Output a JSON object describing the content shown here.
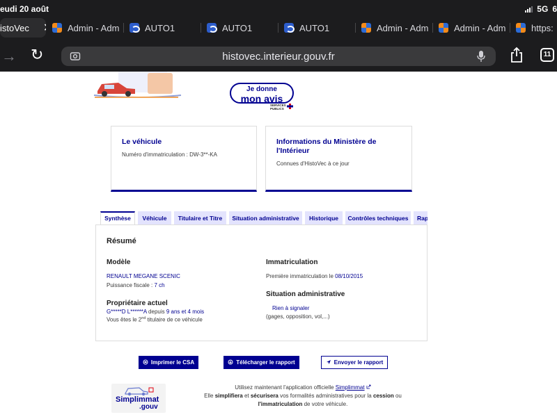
{
  "status_bar": {
    "date": "eudi 20 août",
    "network": "5G",
    "battery": "6"
  },
  "browser": {
    "tabs": [
      {
        "label": "istoVec",
        "active": true,
        "favicon": "none"
      },
      {
        "label": "Admin - Adm",
        "favicon": "admin-icon"
      },
      {
        "label": "AUTO1",
        "favicon": "auto1-icon"
      },
      {
        "label": "AUTO1",
        "favicon": "auto1-icon"
      },
      {
        "label": "AUTO1",
        "favicon": "auto1-icon"
      },
      {
        "label": "Admin - Adm",
        "favicon": "admin-icon"
      },
      {
        "label": "Admin - Adm",
        "favicon": "admin-icon"
      },
      {
        "label": "https:",
        "favicon": "admin-icon"
      }
    ],
    "url": "histovec.interieur.gouv.fr",
    "tab_count": "11"
  },
  "avis_button": {
    "line1": "Je donne",
    "line2": "mon avis",
    "logo_text": [
      "SERVICES",
      "PUBLICS"
    ]
  },
  "cards": [
    {
      "title": "Le véhicule",
      "desc": "Numéro d'immatriculation : DW-3**-KA"
    },
    {
      "title": "Informations du Ministère de l'Intérieur",
      "desc": "Connues d'HistoVec à ce jour"
    }
  ],
  "panel_tabs": [
    {
      "label": "Synthèse",
      "active": true
    },
    {
      "label": "Véhicule"
    },
    {
      "label": "Titulaire et Titre"
    },
    {
      "label": "Situation administrative"
    },
    {
      "label": "Historique"
    },
    {
      "label": "Contrôles techniques"
    },
    {
      "label": "Rap"
    }
  ],
  "summary": {
    "title": "Résumé",
    "modele": {
      "heading": "Modèle",
      "name": "RENAULT MEGANE SCENIC",
      "puissance_label": "Puissance fiscale :",
      "puissance_value": "7 ch"
    },
    "proprietaire": {
      "heading": "Propriétaire actuel",
      "name": "G*****D L******A",
      "since_label": "depuis",
      "since_value": "9 ans et 4 mois",
      "rank_prefix": "Vous êtes le 2",
      "rank_sup": "nd",
      "rank_suffix": "titulaire de ce véhicule"
    },
    "immatriculation": {
      "heading": "Immatriculation",
      "label": "Première immatriculation le",
      "date": "08/10/2015"
    },
    "situation": {
      "heading": "Situation administrative",
      "status": "Rien à signaler",
      "detail": "(gages, opposition, vol,...)"
    }
  },
  "actions": {
    "print_csa": "Imprimer le CSA",
    "download": "Télécharger le rapport",
    "send": "Envoyer le rapport"
  },
  "footer": {
    "logo_main": "Simplimmat",
    "logo_sub": ".gouv",
    "line1_prefix": "Utilisez maintenant l'application officielle",
    "line1_link": "Simplimmat",
    "line2_prefix": "Elle",
    "line2_b1": "simplifiera",
    "line2_mid1": "et",
    "line2_b2": "sécurisera",
    "line2_mid2": "vos formalités administratives pour la",
    "line2_b3": "cession",
    "line2_end": "ou",
    "line3_b": "l'immatriculation",
    "line3_end": "de votre véhicule."
  },
  "colors": {
    "brand_blue": "#000091",
    "tab_bg": "#e3e3fd",
    "chrome_bg": "#1c1c1e"
  }
}
